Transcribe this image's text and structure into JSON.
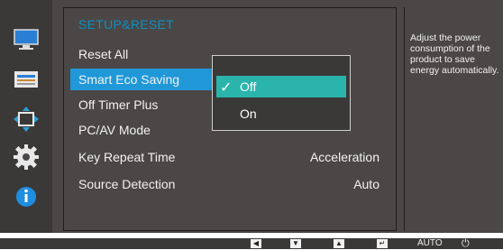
{
  "menu": {
    "title": "SETUP&RESET",
    "items": [
      {
        "label": "Reset All",
        "value": ""
      },
      {
        "label": "Smart Eco Saving",
        "value": ""
      },
      {
        "label": "Off Timer Plus",
        "value": ""
      },
      {
        "label": "PC/AV Mode",
        "value": ""
      },
      {
        "label": "Key Repeat Time",
        "value": "Acceleration"
      },
      {
        "label": "Source Detection",
        "value": "Auto"
      }
    ]
  },
  "submenu": {
    "options": [
      {
        "label": "Off",
        "selected": true
      },
      {
        "label": "On",
        "selected": false
      }
    ]
  },
  "help": {
    "text": "Adjust the power consumption of the product to save energy automatically."
  },
  "categories": [
    "picture-icon",
    "onscreen-display-icon",
    "position-icon",
    "gear-icon",
    "info-icon"
  ],
  "bottom_bar": {
    "buttons": [
      "left-arrow-key",
      "down-arrow-key",
      "up-arrow-key",
      "enter-key"
    ],
    "auto_label": "AUTO"
  },
  "colors": {
    "accent": "#2098d8",
    "title": "#0f8fbf",
    "selected_option": "#2ab4ac"
  }
}
